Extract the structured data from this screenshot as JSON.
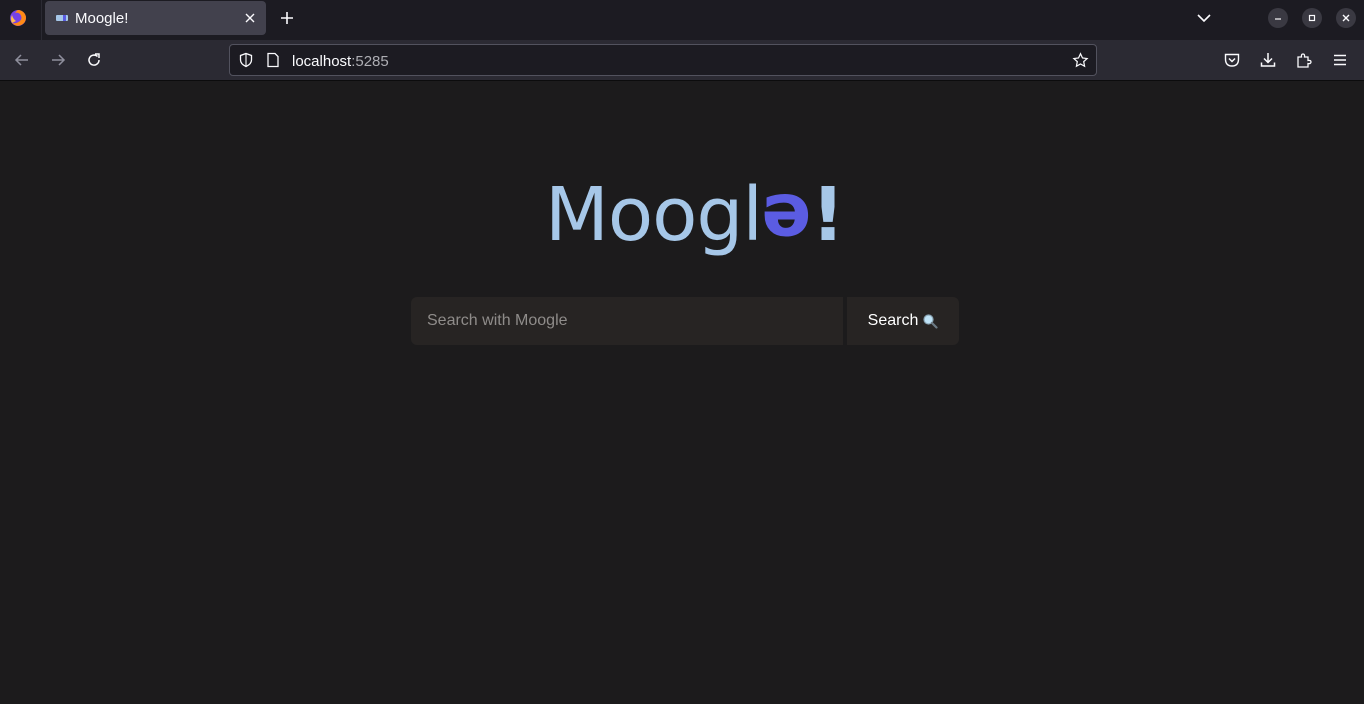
{
  "browser": {
    "tab": {
      "title": "Moogle!",
      "favicon": "moogle-favicon"
    },
    "url": {
      "host": "localhost",
      "port": ":5285"
    },
    "icons": {
      "firefox": "firefox-logo-icon",
      "close_tab": "close-icon",
      "new_tab": "plus-icon",
      "tab_list": "chevron-down-icon",
      "back": "arrow-left-icon",
      "forward": "arrow-right-icon",
      "reload": "reload-icon",
      "shield": "shield-icon",
      "page": "page-icon",
      "bookmark": "star-icon",
      "pocket": "pocket-icon",
      "downloads": "download-icon",
      "extensions": "puzzle-icon",
      "menu": "hamburger-menu-icon",
      "minimize": "minimize-icon",
      "restore": "restore-icon",
      "close_window": "close-icon"
    }
  },
  "page": {
    "logo": {
      "main": "Moogl",
      "flipped": "e",
      "bang": "!"
    },
    "search": {
      "placeholder": "Search with Moogle",
      "value": "",
      "button_label": "Search",
      "button_icon": "magnifier-icon"
    }
  },
  "colors": {
    "page_bg": "#1c1b1c",
    "logo_light": "#a6c7e8",
    "logo_accent": "#5b5ce2",
    "search_bg": "#272423"
  }
}
